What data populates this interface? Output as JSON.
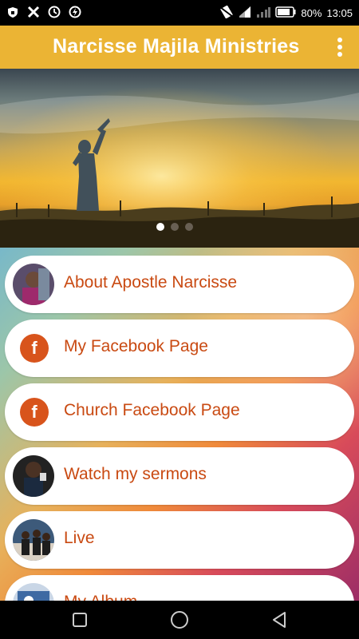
{
  "status": {
    "battery": "80%",
    "time": "13:05",
    "icons_left": [
      "vpn-icon",
      "tools-icon",
      "clock-icon",
      "power-icon"
    ],
    "icons_right": [
      "no-sim-icon",
      "wifi-icon",
      "signal-icon",
      "battery-icon"
    ]
  },
  "appbar": {
    "title": "Narcisse Majila Ministries",
    "menu_icon": "more-vert-icon"
  },
  "carousel": {
    "active_index": 0,
    "slide_count": 3
  },
  "menu": {
    "items": [
      {
        "label": "About Apostle Narcisse",
        "icon": "avatar"
      },
      {
        "label": "My Facebook Page",
        "icon": "facebook-icon"
      },
      {
        "label": "Church Facebook Page",
        "icon": "facebook-icon"
      },
      {
        "label": "Watch my sermons",
        "icon": "avatar"
      },
      {
        "label": "Live",
        "icon": "avatar"
      },
      {
        "label": "My Album",
        "icon": "avatar"
      }
    ]
  },
  "colors": {
    "accent": "#ebb434",
    "label": "#c94a12",
    "facebook_badge": "#d8541c"
  }
}
